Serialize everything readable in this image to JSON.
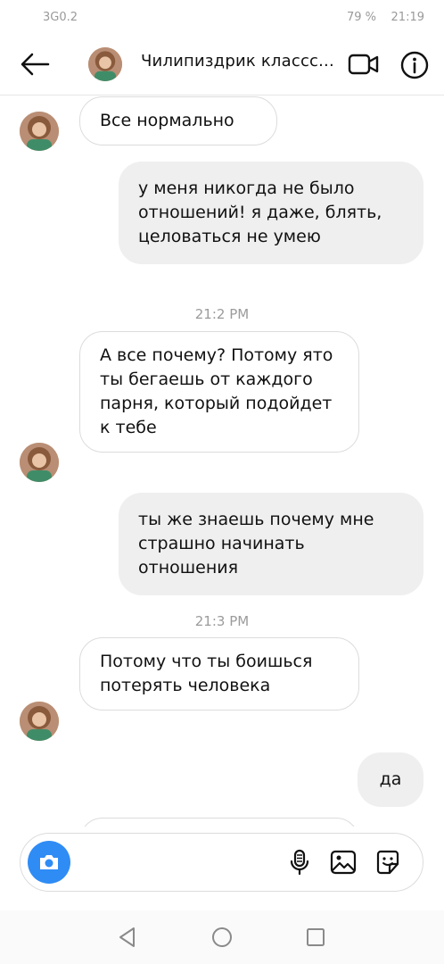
{
  "status_bar": {
    "left": "3G0.2   ",
    "right": "79 %   21:19"
  },
  "header": {
    "title": "Чилипиздрик классс..."
  },
  "messages": [
    {
      "text": "Все нормально"
    },
    {
      "text": "у меня никогда не было отношений! я даже, блять, целоваться не умею"
    },
    {
      "text": "А все почему? Потому ято ты бегаешь от каждого парня, который подойдет к тебе"
    },
    {
      "text": "ты же знаешь почему мне страшно начинать отношения"
    },
    {
      "text": "Потому что ты боишься потерять человека"
    },
    {
      "text": "да"
    }
  ],
  "timestamps": [
    "21:2 PM",
    "21:3 PM"
  ],
  "icons": {
    "back": "arrow-left-icon",
    "video": "video-camera-icon",
    "info": "info-icon",
    "camera": "camera-icon",
    "mic": "microphone-icon",
    "gallery": "image-icon",
    "sticker": "sticker-icon"
  },
  "colors": {
    "accent": "#2f8cf5",
    "incoming_bubble": "#ffffff",
    "outgoing_bubble": "#efefef"
  }
}
